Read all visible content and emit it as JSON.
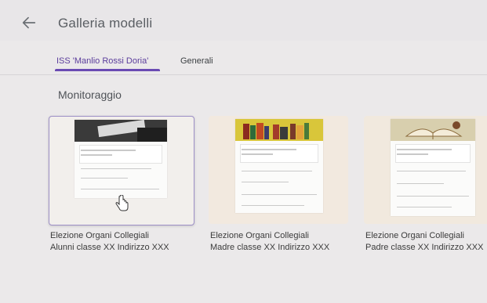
{
  "header": {
    "title": "Galleria modelli",
    "back_icon": "arrow-left-icon"
  },
  "tabs": [
    {
      "label": "ISS 'Manlio Rossi Doria'",
      "selected": true
    },
    {
      "label": "Generali",
      "selected": false
    }
  ],
  "section": {
    "title": "Monitoraggio"
  },
  "templates": [
    {
      "line1": "Elezione Organi Collegiali",
      "line2": "Alunni classe XX Indirizzo XXX"
    },
    {
      "line1": "Elezione Organi Collegiali",
      "line2": "Madre classe XX Indirizzo XXX"
    },
    {
      "line1": "Elezione Organi Collegiali",
      "line2": "Padre classe XX Indirizzo XXX"
    }
  ],
  "colors": {
    "accent": "#6a4bb3",
    "selected_tab_text": "#5b3d9c"
  }
}
